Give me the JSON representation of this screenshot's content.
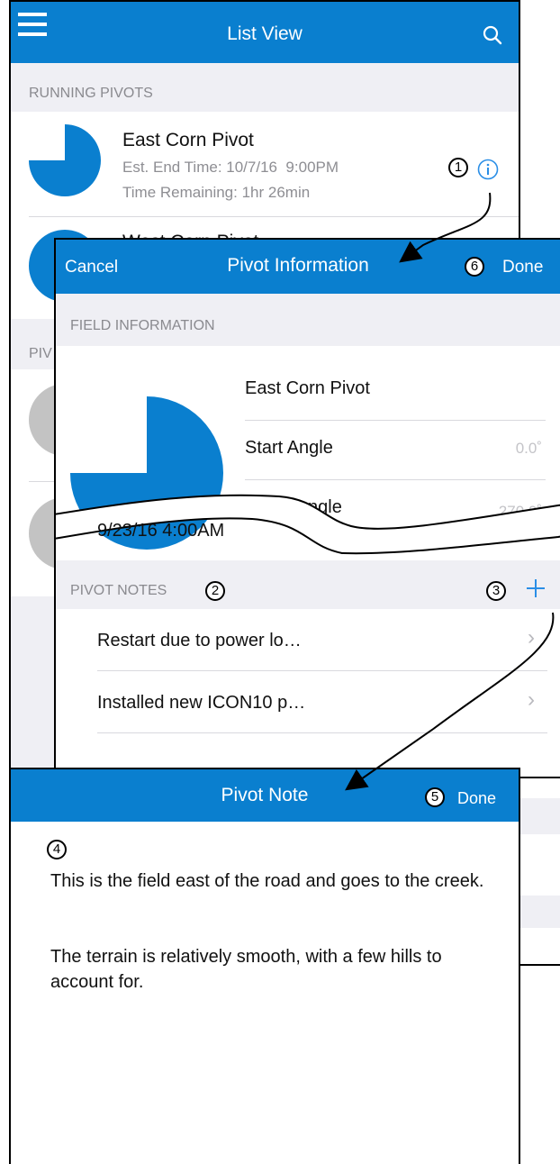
{
  "colors": {
    "accent": "#0a7fcf",
    "accent_light": "#2a8ee6",
    "section_bg": "#efeff4",
    "gray_pie": "#c3c3c3"
  },
  "list_view": {
    "title": "List View",
    "menu_icon": "hamburger-menu-icon",
    "search_icon": "search-icon",
    "section_running": "RUNNING PIVOTS",
    "section_other_partial": "PIV",
    "items": [
      {
        "name": "East Corn Pivot",
        "est_end": "Est. End Time: 10/7/16  9:00PM",
        "remaining": "Time Remaining: 1hr 26min",
        "progress_fraction": 0.75
      },
      {
        "name": "West Corn Pivot"
      }
    ]
  },
  "pivot_info": {
    "cancel": "Cancel",
    "title": "Pivot Information",
    "done": "Done",
    "section_field": "FIELD INFORMATION",
    "field_name": "East Corn Pivot",
    "start_angle_label": "Start Angle",
    "start_angle_value": "0.0˚",
    "end_angle_label_partial": "ngle",
    "end_angle_value": "270.0˚",
    "date": "9/23/16 4:00AM",
    "section_notes": "PIVOT NOTES",
    "add_icon": "plus-icon",
    "notes": [
      {
        "label": "Restart due to power lo…"
      },
      {
        "label": "Installed new ICON10 p…"
      }
    ]
  },
  "pivot_note": {
    "title": "Pivot Note",
    "done": "Done",
    "paragraph1": "This is the field east of the road and goes to the creek.",
    "paragraph2": "The terrain is relatively smooth, with a few hills to account for."
  },
  "callouts": [
    "1",
    "2",
    "3",
    "4",
    "5",
    "6"
  ]
}
